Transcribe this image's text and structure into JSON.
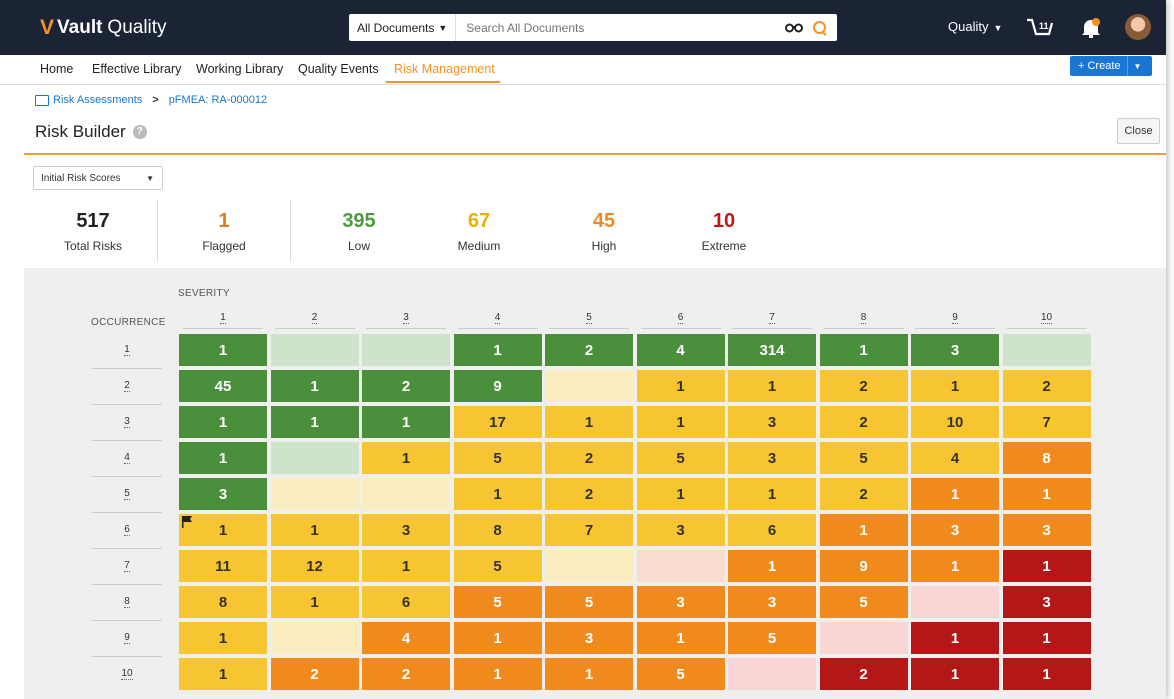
{
  "app": {
    "brand_bold": "Vault",
    "brand_rest": "Quality"
  },
  "search": {
    "scope": "All Documents",
    "placeholder": "Search All Documents"
  },
  "header": {
    "app_menu": "Quality",
    "cart_count": "11"
  },
  "nav": {
    "items": [
      "Home",
      "Effective Library",
      "Working Library",
      "Quality Events",
      "Risk Management"
    ],
    "active_index": 4
  },
  "create_button": {
    "label": "+ Create"
  },
  "breadcrumb": {
    "parent": "Risk Assessments",
    "current": "pFMEA: RA-000012"
  },
  "page": {
    "title": "Risk Builder",
    "close_label": "Close"
  },
  "score_select": {
    "value": "Initial Risk Scores"
  },
  "stats": [
    {
      "value": "517",
      "label": "Total Risks",
      "color": "#222222"
    },
    {
      "value": "1",
      "label": "Flagged",
      "color": "#e07b20"
    },
    {
      "value": "395",
      "label": "Low",
      "color": "#4e9a3c"
    },
    {
      "value": "67",
      "label": "Medium",
      "color": "#e8b000"
    },
    {
      "value": "45",
      "label": "High",
      "color": "#f08a1c"
    },
    {
      "value": "10",
      "label": "Extreme",
      "color": "#c01818"
    }
  ],
  "matrix": {
    "severity_label": "SEVERITY",
    "occurrence_label": "OCCURRENCE",
    "severity_headers": [
      "1",
      "2",
      "3",
      "4",
      "5",
      "6",
      "7",
      "8",
      "9",
      "10"
    ],
    "occurrence_headers": [
      "1",
      "2",
      "3",
      "4",
      "5",
      "6",
      "7",
      "8",
      "9",
      "10"
    ],
    "colors": {
      "L": "#4a8f3c",
      "l": "#cfe3cc",
      "M": "#f7c531",
      "m": "#fbedbf",
      "H": "#f08a1c",
      "h": "#f9dccd",
      "E": "#b31717",
      "e": "#f9d6d6"
    },
    "levels": [
      [
        "L",
        "l",
        "l",
        "L",
        "L",
        "L",
        "L",
        "L",
        "L",
        "l"
      ],
      [
        "L",
        "L",
        "L",
        "L",
        "m",
        "M",
        "M",
        "M",
        "M",
        "M"
      ],
      [
        "L",
        "L",
        "L",
        "M",
        "M",
        "M",
        "M",
        "M",
        "M",
        "M"
      ],
      [
        "L",
        "l",
        "M",
        "M",
        "M",
        "M",
        "M",
        "M",
        "M",
        "H"
      ],
      [
        "L",
        "m",
        "m",
        "M",
        "M",
        "M",
        "M",
        "M",
        "H",
        "H"
      ],
      [
        "M",
        "M",
        "M",
        "M",
        "M",
        "M",
        "M",
        "H",
        "H",
        "H"
      ],
      [
        "M",
        "M",
        "M",
        "M",
        "m",
        "h",
        "H",
        "H",
        "H",
        "E"
      ],
      [
        "M",
        "M",
        "M",
        "H",
        "H",
        "H",
        "H",
        "H",
        "e",
        "E"
      ],
      [
        "M",
        "m",
        "H",
        "H",
        "H",
        "H",
        "H",
        "e",
        "E",
        "E"
      ],
      [
        "M",
        "H",
        "H",
        "H",
        "H",
        "H",
        "e",
        "E",
        "E",
        "E"
      ]
    ],
    "counts": [
      [
        "1",
        "",
        "",
        "1",
        "2",
        "4",
        "314",
        "1",
        "3",
        ""
      ],
      [
        "45",
        "1",
        "2",
        "9",
        "",
        "1",
        "1",
        "2",
        "1",
        "2"
      ],
      [
        "1",
        "1",
        "1",
        "17",
        "1",
        "1",
        "3",
        "2",
        "10",
        "7"
      ],
      [
        "1",
        "",
        "1",
        "5",
        "2",
        "5",
        "3",
        "5",
        "4",
        "8"
      ],
      [
        "3",
        "",
        "",
        "1",
        "2",
        "1",
        "1",
        "2",
        "1",
        "1"
      ],
      [
        "1",
        "1",
        "3",
        "8",
        "7",
        "3",
        "6",
        "1",
        "3",
        "3"
      ],
      [
        "11",
        "12",
        "1",
        "5",
        "",
        "",
        "1",
        "9",
        "1",
        "1"
      ],
      [
        "8",
        "1",
        "6",
        "5",
        "5",
        "3",
        "3",
        "5",
        "",
        "3"
      ],
      [
        "1",
        "",
        "4",
        "1",
        "3",
        "1",
        "5",
        "",
        "1",
        "1"
      ],
      [
        "1",
        "2",
        "2",
        "1",
        "1",
        "5",
        "",
        "2",
        "1",
        "1"
      ]
    ],
    "flagged_cell": [
      5,
      0
    ]
  }
}
